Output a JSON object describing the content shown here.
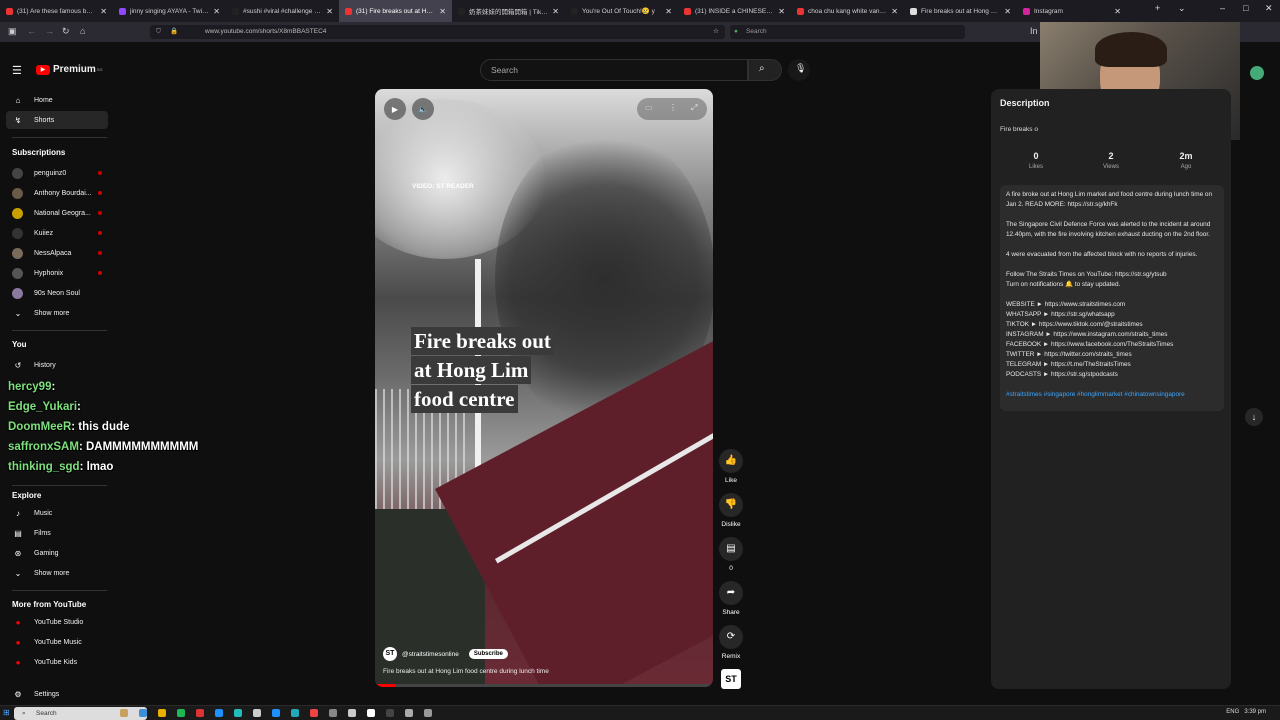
{
  "browser": {
    "tabs": [
      {
        "label": "(31) Are these famous butter ch",
        "color": "#e33"
      },
      {
        "label": "jinny singing AYAYA - Twitch",
        "color": "#9146ff"
      },
      {
        "label": "#sushi #viral #challenge #puzzl",
        "color": "#222"
      },
      {
        "label": "(31) Fire breaks out at Hong",
        "color": "#e33",
        "active": true
      },
      {
        "label": "奶茶妹妹的開箱開箱 | TikTok",
        "color": "#222"
      },
      {
        "label": "You're Out Of Touch!😢 y",
        "color": "#222"
      },
      {
        "label": "(31) INSIDE a CHINESE MA",
        "color": "#e33"
      },
      {
        "label": "choa chu kang white van drive",
        "color": "#e33"
      },
      {
        "label": "Fire breaks out at Hong Lim fo",
        "color": "#ddd"
      },
      {
        "label": "Instagram",
        "color": "#d6249f"
      }
    ],
    "url": "www.youtube.com/shorts/X8mBBASTEC4",
    "search_placeholder": "Search"
  },
  "youtube": {
    "logo_text": "Premium",
    "logo_badge": "SG",
    "search_placeholder": "Search"
  },
  "sidebar": {
    "main": [
      {
        "label": "Home",
        "icon": "⌂"
      },
      {
        "label": "Shorts",
        "icon": "↯",
        "active": true
      }
    ],
    "subscriptions_heading": "Subscriptions",
    "subscriptions": [
      {
        "label": "penguinz0"
      },
      {
        "label": "Anthony Bourdai..."
      },
      {
        "label": "National Geogra..."
      },
      {
        "label": "Kuiiez"
      },
      {
        "label": "NessAlpaca"
      },
      {
        "label": "Hyphonix"
      },
      {
        "label": "90s Neon Soul"
      }
    ],
    "show_more": "Show more",
    "you_heading": "You",
    "you_items": [
      {
        "label": "History",
        "icon": "↺"
      }
    ],
    "explore_heading": "Explore",
    "explore": [
      {
        "label": "Music",
        "icon": "♪"
      },
      {
        "label": "Films",
        "icon": "▤"
      },
      {
        "label": "Gaming",
        "icon": "⊛"
      }
    ],
    "show_more_2": "Show more",
    "more_heading": "More from YouTube",
    "more": [
      {
        "label": "YouTube Studio"
      },
      {
        "label": "YouTube Music"
      },
      {
        "label": "YouTube Kids"
      }
    ],
    "settings": "Settings"
  },
  "chat": [
    {
      "user": "hercy99",
      "msg": ""
    },
    {
      "user": "Edge_Yukari",
      "msg": ""
    },
    {
      "user": "DoomMeeR",
      "msg": "this dude"
    },
    {
      "user": "saffronxSAM",
      "msg": "DAMMMMMMMMMM"
    },
    {
      "user": "thinking_sgd",
      "msg": "lmao"
    }
  ],
  "video": {
    "credit": "VIDEO: ST READER",
    "title_lines": [
      "Fire breaks out",
      "at Hong Lim",
      "food centre"
    ],
    "channel": "@straitstimesonline",
    "channel_logo": "ST",
    "subscribe": "Subscribe",
    "caption": "Fire breaks out at Hong Lim food centre during lunch time",
    "progress_fraction": 0.06
  },
  "actions": [
    {
      "label": "Like",
      "icon": "👍"
    },
    {
      "label": "Dislike",
      "icon": "👎"
    },
    {
      "label": "0",
      "icon": "▤"
    },
    {
      "label": "Share",
      "icon": "➦"
    },
    {
      "label": "Remix",
      "icon": "⟳"
    }
  ],
  "description": {
    "heading": "Description",
    "subtitle": "Fire breaks o",
    "stats": [
      {
        "n": "0",
        "l": "Likes"
      },
      {
        "n": "2",
        "l": "Views"
      },
      {
        "n": "2m",
        "l": "Ago"
      }
    ],
    "paragraphs": [
      "A fire broke out at Hong Lim market and food centre during lunch time on Jan 2. READ MORE: https://str.sg/khFk",
      "The Singapore Civil Defence Force was alerted to the incident at around 12.40pm, with the fire involving kitchen exhaust ducting on the 2nd floor.",
      "4 were evacuated from the affected block with no reports of injuries.",
      "Follow The Straits Times on YouTube: https://str.sg/ytsub\nTurn on notifications 🔔 to stay updated.",
      "WEBSITE ► https://www.straitstimes.com\nWHATSAPP ► https://str.sg/whatsapp\nTIKTOK ► https://www.tiktok.com/@straitstimes\nINSTAGRAM ► https://www.instagram.com/straits_times\nFACEBOOK ► https://www.facebook.com/TheStraitsTimes\nTWITTER ► https://twitter.com/straits_times\nTELEGRAM ► https://t.me/TheStraitsTimes\nPODCASTS ► https://str.sg/stpodcasts"
    ],
    "tags": "#straitstimes #singapore #honglimmarket #chinatownsingapore"
  },
  "taskbar": {
    "search": "Search",
    "lang": "ENG",
    "time": "3:39 pm"
  }
}
